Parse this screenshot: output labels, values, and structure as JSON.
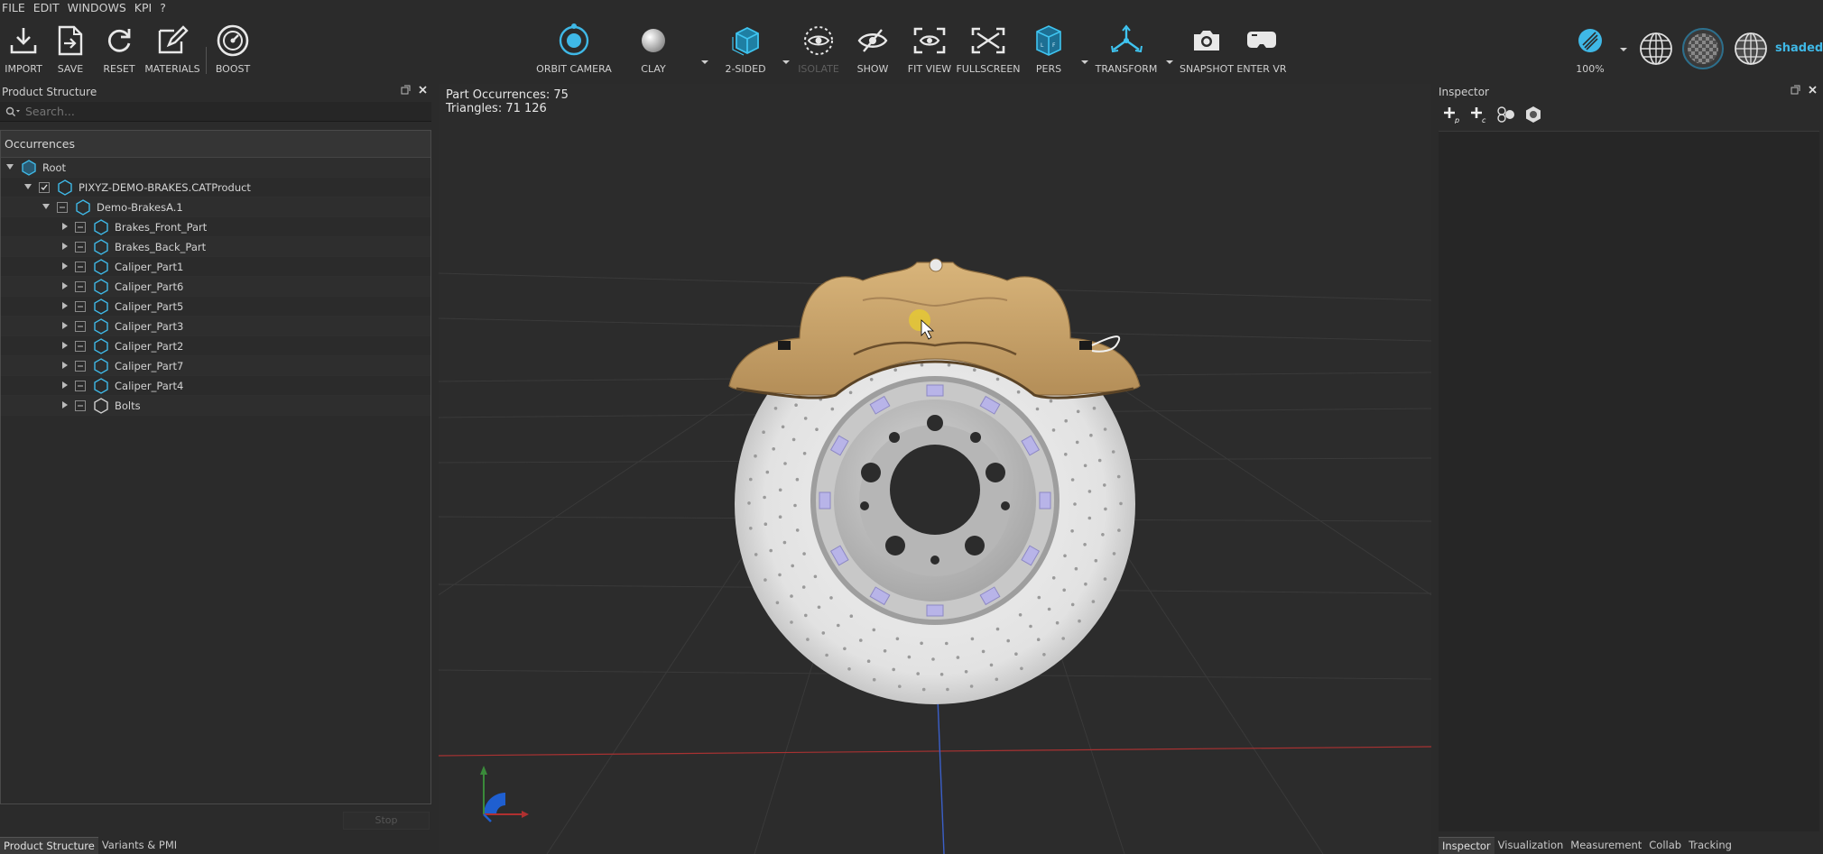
{
  "menu": [
    "FILE",
    "EDIT",
    "WINDOWS",
    "KPI",
    "?"
  ],
  "toolbar": {
    "import": "IMPORT",
    "save": "SAVE",
    "reset": "RESET",
    "materials": "MATERIALS",
    "boost": "BOOST",
    "orbit_camera": "ORBIT CAMERA",
    "clay": "CLAY",
    "two_sided": "2-SIDED",
    "isolate": "ISOLATE",
    "show": "SHOW",
    "fit_view": "FIT VIEW",
    "fullscreen": "FULLSCREEN",
    "pers": "PERS",
    "transform": "TRANSFORM",
    "snapshot": "SNAPSHOT",
    "enter_vr": "ENTER VR",
    "zoom": "100%",
    "render_mode": "shaded"
  },
  "left_panel": {
    "title": "Product Structure",
    "search_placeholder": "Search...",
    "tree_header": "Occurrences",
    "tree": [
      {
        "label": "Root",
        "depth": 0,
        "expanded": true,
        "checkbox": false
      },
      {
        "label": "PIXYZ-DEMO-BRAKES.CATProduct",
        "depth": 1,
        "expanded": true,
        "checkbox": true,
        "checked": true
      },
      {
        "label": "Demo-BrakesA.1",
        "depth": 2,
        "expanded": true,
        "checkbox": true,
        "checked": false
      },
      {
        "label": "Brakes_Front_Part",
        "depth": 3,
        "expanded": false,
        "checkbox": true,
        "checked": false
      },
      {
        "label": "Brakes_Back_Part",
        "depth": 3,
        "expanded": false,
        "checkbox": true,
        "checked": false
      },
      {
        "label": "Caliper_Part1",
        "depth": 3,
        "expanded": false,
        "checkbox": true,
        "checked": false
      },
      {
        "label": "Caliper_Part6",
        "depth": 3,
        "expanded": false,
        "checkbox": true,
        "checked": false
      },
      {
        "label": "Caliper_Part5",
        "depth": 3,
        "expanded": false,
        "checkbox": true,
        "checked": false
      },
      {
        "label": "Caliper_Part3",
        "depth": 3,
        "expanded": false,
        "checkbox": true,
        "checked": false
      },
      {
        "label": "Caliper_Part2",
        "depth": 3,
        "expanded": false,
        "checkbox": true,
        "checked": false
      },
      {
        "label": "Caliper_Part7",
        "depth": 3,
        "expanded": false,
        "checkbox": true,
        "checked": false
      },
      {
        "label": "Caliper_Part4",
        "depth": 3,
        "expanded": false,
        "checkbox": true,
        "checked": false
      },
      {
        "label": "Bolts",
        "depth": 3,
        "expanded": false,
        "checkbox": true,
        "checked": false
      }
    ],
    "stop_button": "Stop",
    "tabs": [
      "Product Structure",
      "Variants & PMI"
    ]
  },
  "viewport": {
    "part_occurrences": "Part Occurrences: 75",
    "triangles": "Triangles: 71 126"
  },
  "right_panel": {
    "title": "Inspector",
    "tabs": [
      "Inspector",
      "Visualization",
      "Measurement",
      "Collab",
      "Tracking"
    ]
  },
  "colors": {
    "accent": "#3fb8e6",
    "caliper": "#c9a56e",
    "disc": "#e0e0e0",
    "background": "#2b2b2b"
  }
}
